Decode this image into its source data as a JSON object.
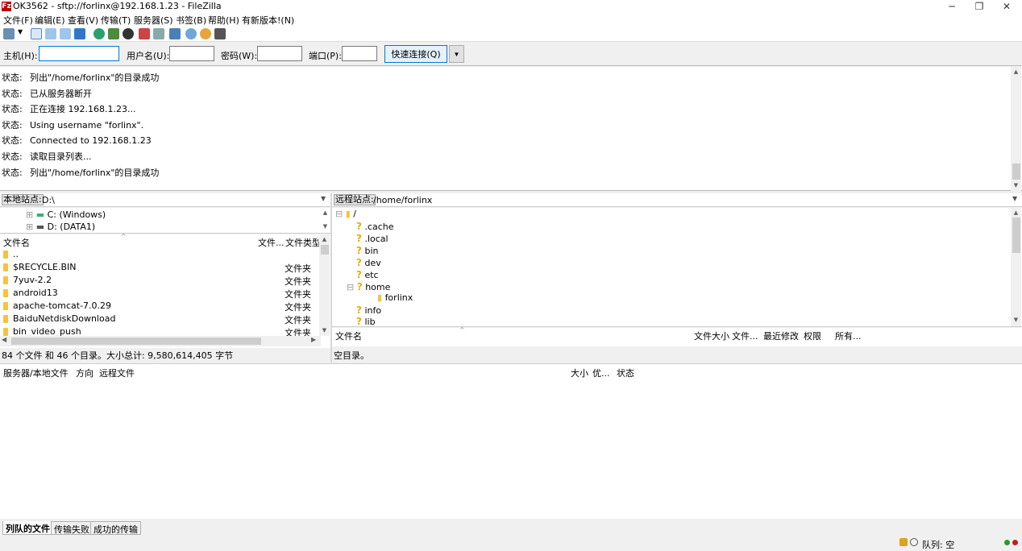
{
  "window": {
    "title": "OK3562 - sftp://forlinx@192.168.1.23 - FileZilla",
    "icon_letter": "Fz",
    "minimize": "─",
    "maximize": "❐",
    "close": "✕"
  },
  "menu": [
    "文件(F)",
    "编辑(E)",
    "查看(V)",
    "传输(T)",
    "服务器(S)",
    "书签(B)",
    "帮助(H)",
    "有新版本!(N)"
  ],
  "quickconnect": {
    "host_label": "主机(H):",
    "host_value": "",
    "user_label": "用户名(U):",
    "user_value": "",
    "pass_label": "密码(W):",
    "pass_value": "",
    "port_label": "端口(P):",
    "port_value": "",
    "button_label": "快速连接(Q)",
    "dropdown_glyph": "▼"
  },
  "log": {
    "label": "状态:",
    "lines": [
      "列出\"/home/forlinx\"的目录成功",
      "已从服务器断开",
      "正在连接 192.168.1.23...",
      "Using username \"forlinx\".",
      "Connected to 192.168.1.23",
      "读取目录列表...",
      "列出\"/home/forlinx\"的目录成功"
    ]
  },
  "local": {
    "site_label": "本地站点:",
    "site_path": "D:\\",
    "tree": [
      "C: (Windows)",
      "D: (DATA1)"
    ],
    "columns": {
      "name": "文件名",
      "size": "文件...",
      "type": "文件类型"
    },
    "files": [
      {
        "name": "..",
        "type": ""
      },
      {
        "name": "$RECYCLE.BIN",
        "type": "文件夹"
      },
      {
        "name": "7yuv-2.2",
        "type": "文件夹"
      },
      {
        "name": "android13",
        "type": "文件夹"
      },
      {
        "name": "apache-tomcat-7.0.29",
        "type": "文件夹"
      },
      {
        "name": "BaiduNetdiskDownload",
        "type": "文件夹"
      },
      {
        "name": "bin_video_push",
        "type": "文件夹"
      }
    ],
    "status": "84 个文件 和 46 个目录。大小总计: 9,580,614,405 字节"
  },
  "remote": {
    "site_label": "远程站点:",
    "site_path": "/home/forlinx",
    "tree_root": "/",
    "tree": [
      ".cache",
      ".local",
      "bin",
      "dev",
      "etc",
      "home",
      "info",
      "lib"
    ],
    "tree_child": "forlinx",
    "columns": {
      "name": "文件名",
      "size": "文件大小",
      "type": "文件...",
      "modified": "最近修改",
      "perms": "权限",
      "owner": "所有..."
    },
    "status": "空目录。"
  },
  "queue": {
    "columns": {
      "server": "服务器/本地文件",
      "direction": "方向",
      "remote": "远程文件",
      "size": "大小",
      "priority": "优...",
      "status": "状态"
    },
    "tabs": [
      "列队的文件",
      "传输失败",
      "成功的传输"
    ]
  },
  "statusbar": {
    "queue": "队列: 空"
  },
  "colors": {
    "accent": "#0078d7",
    "folder": "#f5c242",
    "question": "#e0b000"
  }
}
